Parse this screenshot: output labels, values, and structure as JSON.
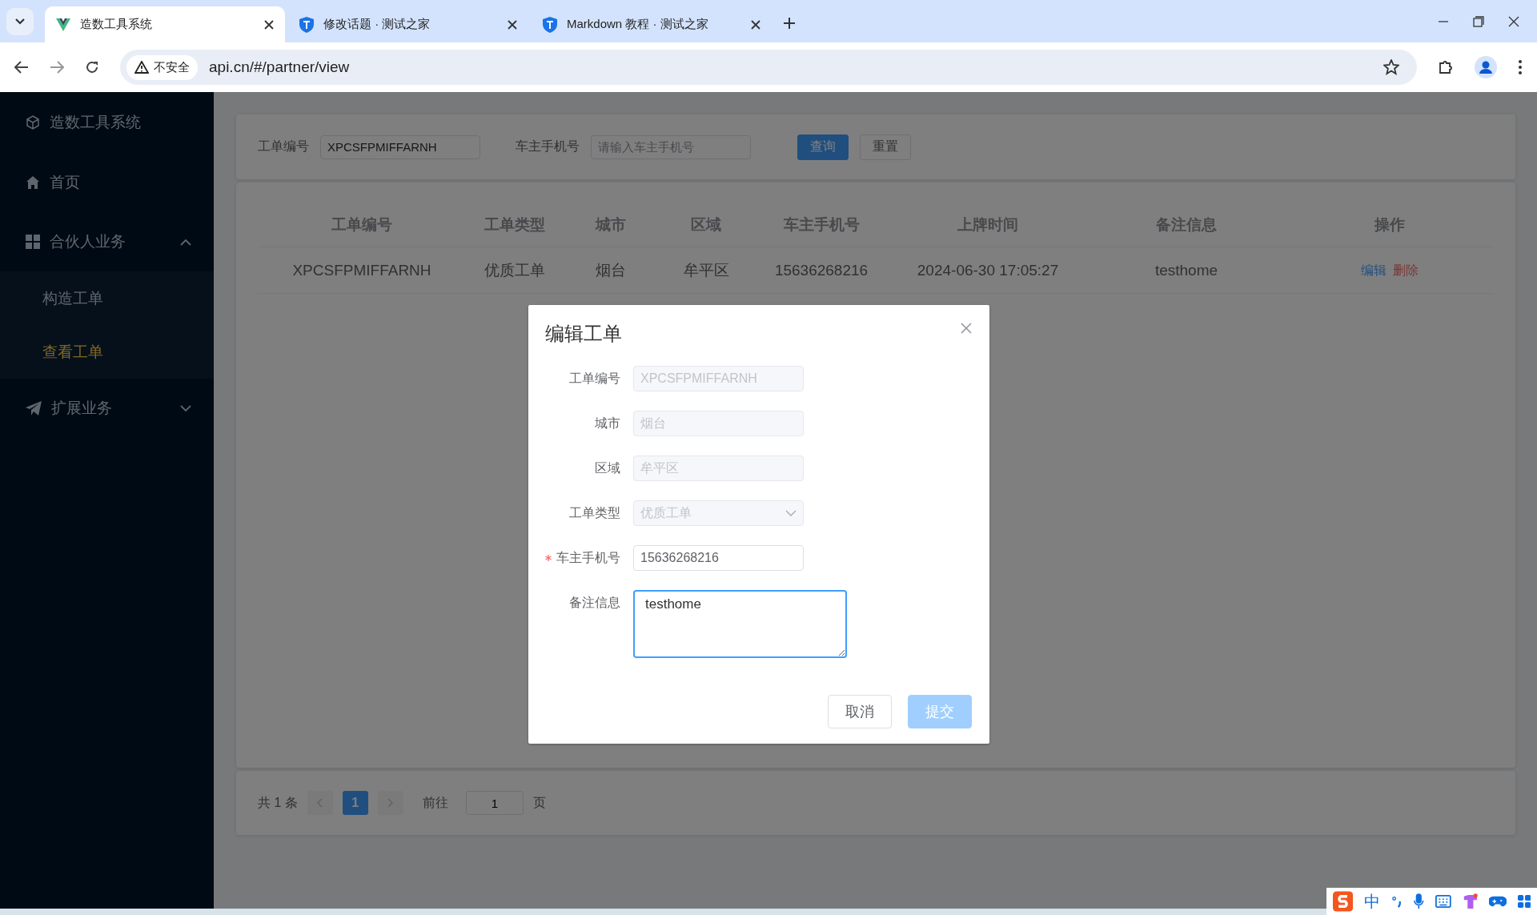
{
  "browser": {
    "tabs": [
      {
        "title": "造数工具系统",
        "selected": true
      },
      {
        "title": "修改话题 · 测试之家",
        "selected": false
      },
      {
        "title": "Markdown 教程 · 测试之家",
        "selected": false
      }
    ],
    "security": "不安全",
    "url": "api.cn/#/partner/view"
  },
  "sidebar": {
    "title": "造数工具系统",
    "items": [
      {
        "label": "首页"
      },
      {
        "label": "合伙人业务",
        "expanded": true,
        "children": [
          {
            "label": "构造工单",
            "selected": false
          },
          {
            "label": "查看工单",
            "selected": true
          }
        ]
      },
      {
        "label": "扩展业务",
        "expanded": false
      }
    ]
  },
  "search": {
    "fields": [
      {
        "label": "工单编号",
        "value": "XPCSFPMIFFARNH"
      },
      {
        "label": "车主手机号",
        "placeholder": "请输入车主手机号"
      }
    ],
    "buttons": [
      {
        "label": "查询",
        "kind": "primary"
      },
      {
        "label": "重置",
        "kind": "default"
      }
    ]
  },
  "table": {
    "columns": [
      "工单编号",
      "工单类型",
      "城市",
      "区域",
      "车主手机号",
      "上牌时间",
      "备注信息",
      "操作"
    ],
    "rows": [
      {
        "cells": [
          "XPCSFPMIFFARNH",
          "优质工单",
          "烟台",
          "牟平区",
          "15636268216",
          "2024-06-30 17:05:27",
          "testhome"
        ],
        "actions": [
          {
            "label": "编辑",
            "kind": "edit"
          },
          {
            "label": "删除",
            "kind": "delete"
          }
        ]
      }
    ]
  },
  "pagination": {
    "total": "共 1 条",
    "pages": [
      {
        "label": "1",
        "selected": true
      }
    ],
    "goto_label": "前往",
    "goto_value": "1",
    "unit": "页"
  },
  "dialog": {
    "title": "编辑工单",
    "fields": [
      {
        "label": "工单编号",
        "kind": "input",
        "value": "XPCSFPMIFFARNH",
        "disabled": true,
        "required": false,
        "focused": false
      },
      {
        "label": "城市",
        "kind": "input",
        "value": "烟台",
        "disabled": true,
        "required": false,
        "focused": false
      },
      {
        "label": "区域",
        "kind": "input",
        "value": "牟平区",
        "disabled": true,
        "required": false,
        "focused": false
      },
      {
        "label": "工单类型",
        "kind": "select",
        "value": "优质工单",
        "disabled": true,
        "required": false,
        "focused": false
      },
      {
        "label": "车主手机号",
        "kind": "input",
        "value": "15636268216",
        "disabled": false,
        "required": true,
        "focused": false
      },
      {
        "label": "备注信息",
        "kind": "textarea",
        "value": "testhome",
        "disabled": false,
        "required": false,
        "focused": true
      }
    ],
    "buttons": [
      {
        "label": "取消",
        "kind": "default",
        "disabled": false
      },
      {
        "label": "提交",
        "kind": "primary",
        "disabled": true
      }
    ]
  },
  "ime": {
    "mode": "中"
  }
}
